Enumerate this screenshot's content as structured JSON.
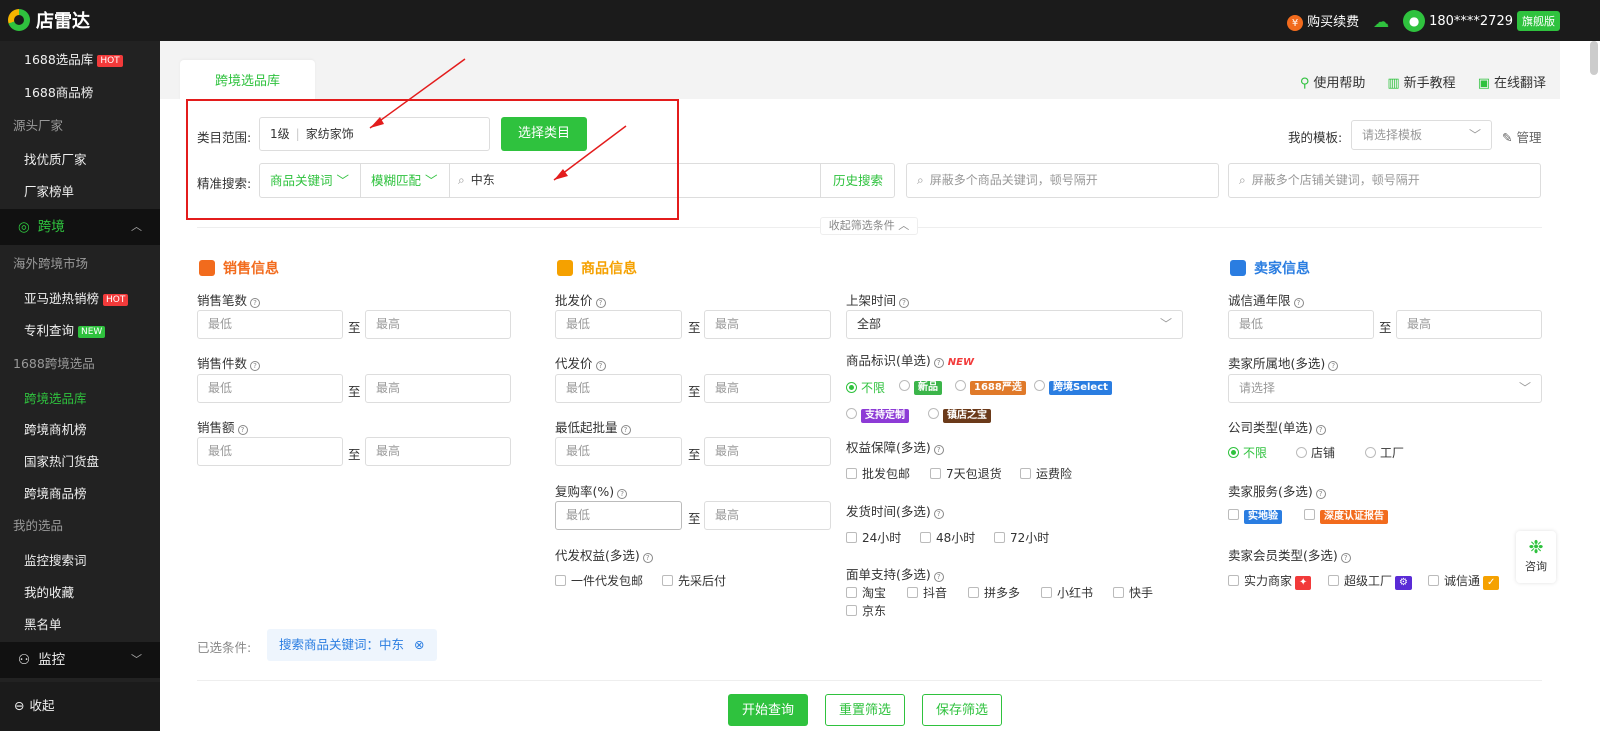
{
  "topbar": {
    "brand": "店雷达",
    "coin_symbol": "¥",
    "buy_renew": "购买续费",
    "phone": "180****2729",
    "edition": "旗舰版"
  },
  "sidebar": {
    "items": [
      {
        "label": "1688选品库",
        "badge": "HOT"
      },
      {
        "label": "1688商品榜"
      },
      {
        "label": "源头厂家",
        "group": true
      },
      {
        "label": "找优质厂家"
      },
      {
        "label": "厂家榜单"
      },
      {
        "label": "跨境",
        "head": true
      },
      {
        "label": "海外跨境市场",
        "group": true
      },
      {
        "label": "亚马逊热销榜",
        "badge": "HOT"
      },
      {
        "label": "专利查询",
        "badge": "NEW"
      },
      {
        "label": "1688跨境选品",
        "group": true
      },
      {
        "label": "跨境选品库",
        "active": true
      },
      {
        "label": "跨境商机榜"
      },
      {
        "label": "国家热门货盘"
      },
      {
        "label": "跨境商品榜"
      },
      {
        "label": "我的选品",
        "group": true
      },
      {
        "label": "监控搜索词"
      },
      {
        "label": "我的收藏"
      },
      {
        "label": "黑名单"
      },
      {
        "label": "监控",
        "head": true
      }
    ],
    "collapse": "收起"
  },
  "tab": "跨境选品库",
  "help_links": [
    "使用帮助",
    "新手教程",
    "在线翻译"
  ],
  "filters": {
    "category_label": "类目范围:",
    "category_level": "1级",
    "category_value": "家纺家饰",
    "choose_category": "选择类目",
    "template_label": "我的模板:",
    "template_placeholder": "请选择模板",
    "manage": "管理",
    "precise_label": "精准搜索:",
    "keyword_type": "商品关键词",
    "match_type": "模糊匹配",
    "search_value": "中东",
    "history": "历史搜索",
    "block_goods_placeholder": "屏蔽多个商品关键词，顿号隔开",
    "block_shop_placeholder": "屏蔽多个店铺关键词，顿号隔开",
    "collapse_filters": "收起筛选条件"
  },
  "sales": {
    "title": "销售信息",
    "fields": [
      "销售笔数",
      "销售件数",
      "销售额"
    ],
    "min": "最低",
    "max": "最高",
    "to": "至"
  },
  "goods": {
    "title": "商品信息",
    "fields": [
      "批发价",
      "代发价",
      "最低起批量",
      "复购率(%)"
    ],
    "dropship_rights": "代发权益(多选)",
    "dropship_opts": [
      "一件代发包邮",
      "先采后付"
    ],
    "listing_time": "上架时间",
    "listing_value": "全部",
    "mark_label": "商品标识(单选)",
    "mark_new": "NEW",
    "mark_opts": [
      "不限",
      "新品",
      "1688严选",
      "跨境Select",
      "支持定制",
      "镇店之宝"
    ],
    "guarantee_label": "权益保障(多选)",
    "guarantee_opts": [
      "批发包邮",
      "7天包退货",
      "运费险"
    ],
    "ship_label": "发货时间(多选)",
    "ship_opts": [
      "24小时",
      "48小时",
      "72小时"
    ],
    "waybill_label": "面单支持(多选)",
    "waybill_opts": [
      "淘宝",
      "抖音",
      "拼多多",
      "小红书",
      "快手",
      "京东"
    ]
  },
  "seller": {
    "title": "卖家信息",
    "years_label": "诚信通年限",
    "location_label": "卖家所属地(多选)",
    "location_placeholder": "请选择",
    "company_label": "公司类型(单选)",
    "company_opts": [
      "不限",
      "店铺",
      "工厂"
    ],
    "service_label": "卖家服务(多选)",
    "service_opts": [
      "实地验",
      "深度认证报告"
    ],
    "member_label": "卖家会员类型(多选)",
    "member_opts": [
      "实力商家",
      "超级工厂",
      "诚信通"
    ]
  },
  "selected": {
    "label": "已选条件:",
    "chip": "搜索商品关键词：中东"
  },
  "actions": [
    "开始查询",
    "重置筛选",
    "保存筛选"
  ],
  "consult": "咨询",
  "colors": {
    "accent": "#2fc23e",
    "annotation": "#e31c1c"
  }
}
